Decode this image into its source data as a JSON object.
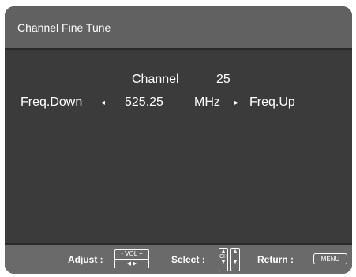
{
  "window": {
    "title": "Channel Fine Tune"
  },
  "channel": {
    "label": "Channel",
    "number": "25"
  },
  "tune": {
    "down_label": "Freq.Down",
    "left_arrow": "◂",
    "frequency": "525.25",
    "unit": "MHz",
    "right_arrow": "▸",
    "up_label": "Freq.Up"
  },
  "footer": {
    "adjust_label": "Adjust :",
    "vol_key": "- VOL +",
    "vol_arrows": "◀      ▶",
    "select_label": "Select :",
    "ch_key": "CH",
    "return_label": "Return :",
    "menu_key": "MENU"
  }
}
